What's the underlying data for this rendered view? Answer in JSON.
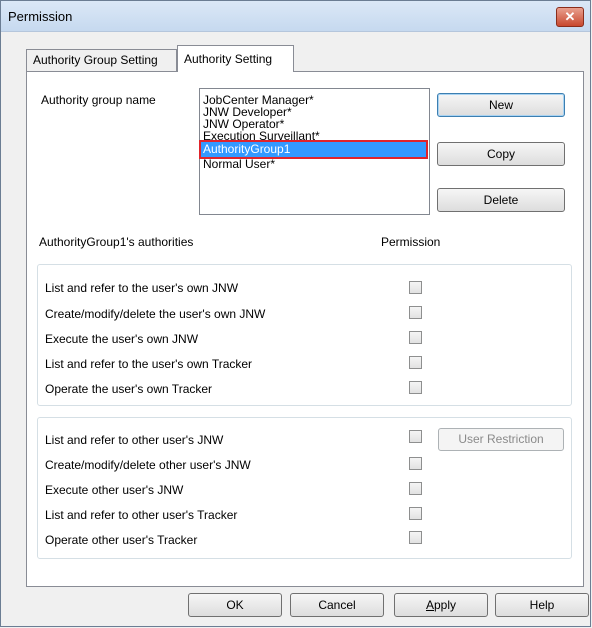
{
  "window": {
    "title": "Permission",
    "close_glyph": "✕"
  },
  "tabs": [
    {
      "label": "Authority Group Setting",
      "active": false
    },
    {
      "label": "Authority Setting",
      "active": true
    }
  ],
  "authority_group": {
    "label": "Authority group name",
    "items": [
      "JobCenter Manager*",
      "JNW Developer*",
      "JNW Operator*",
      "Execution Surveillant*",
      "AuthorityGroup1",
      "Normal User*"
    ],
    "selected": "AuthorityGroup1"
  },
  "side_buttons": {
    "new": "New",
    "copy": "Copy",
    "delete": "Delete"
  },
  "authorities_heading": "AuthorityGroup1's authorities",
  "permission_heading": "Permission",
  "own_permissions": [
    {
      "label": "List and refer to the user's own JNW",
      "checked": false
    },
    {
      "label": "Create/modify/delete the user's own JNW",
      "checked": false
    },
    {
      "label": "Execute the user's own JNW",
      "checked": false
    },
    {
      "label": "List and refer to  the user's own Tracker",
      "checked": false
    },
    {
      "label": "Operate the user's own Tracker",
      "checked": false
    }
  ],
  "other_permissions": [
    {
      "label": "List and refer to other user's JNW",
      "checked": false
    },
    {
      "label": "Create/modify/delete other user's JNW",
      "checked": false
    },
    {
      "label": "Execute other user's JNW",
      "checked": false
    },
    {
      "label": "List and refer to other user's Tracker",
      "checked": false
    },
    {
      "label": "Operate other user's Tracker",
      "checked": false
    }
  ],
  "user_restriction_button": "User Restriction",
  "footer_buttons": {
    "ok": "OK",
    "cancel": "Cancel",
    "apply_prefix": "",
    "apply_mnemonic": "A",
    "apply_rest": "pply",
    "help": "Help"
  }
}
